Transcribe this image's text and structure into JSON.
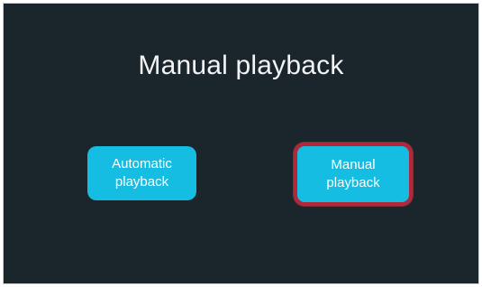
{
  "screen": {
    "title": "Manual playback"
  },
  "buttons": {
    "automatic_label": "Automatic playback",
    "manual_label": "Manual playback"
  },
  "colors": {
    "background": "#1b252c",
    "button": "#14bde1",
    "selected_outline": "#b2273a"
  }
}
